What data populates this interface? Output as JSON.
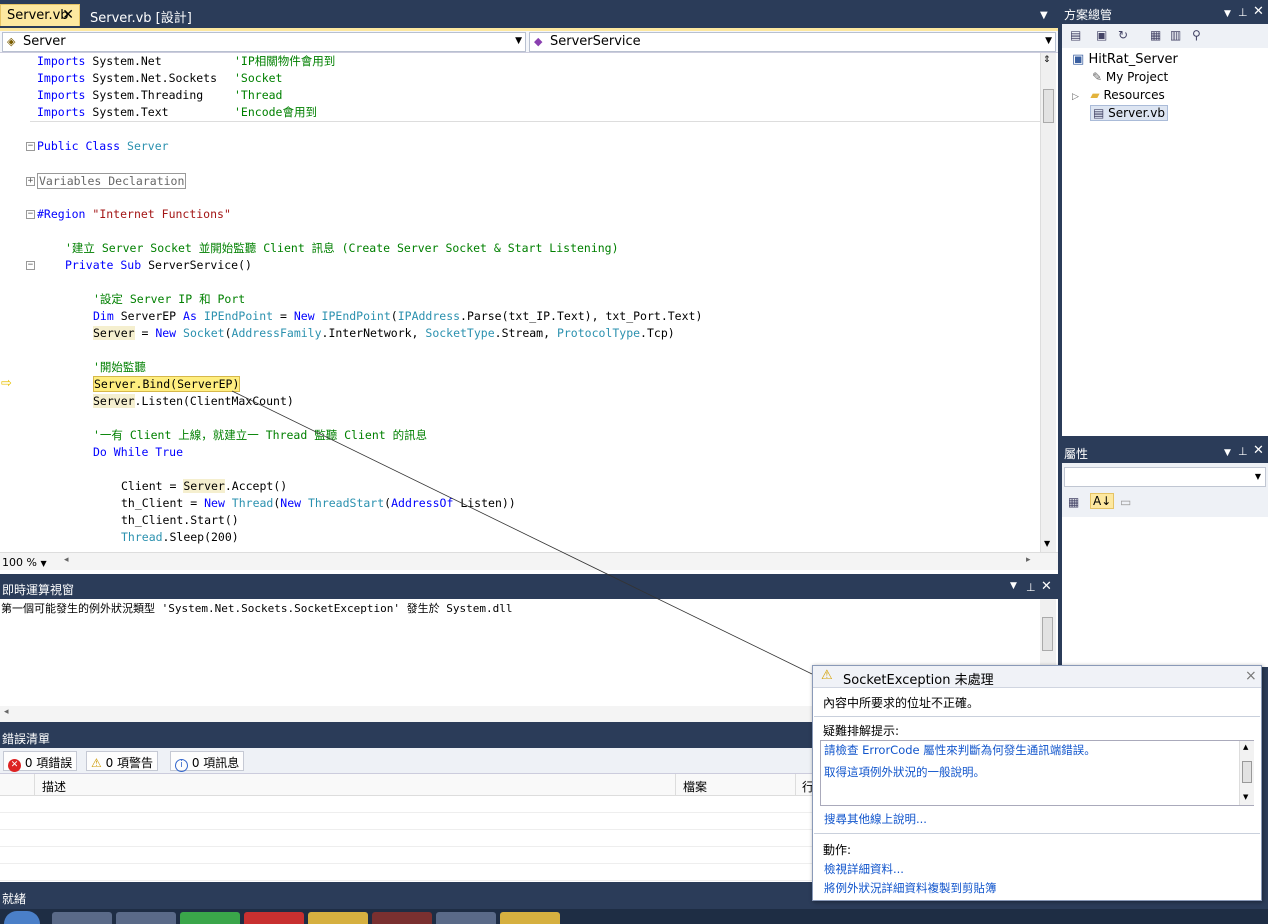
{
  "tabs": [
    {
      "label": "Server.vb",
      "close": "✕"
    },
    {
      "label": "Server.vb [設計]"
    }
  ],
  "nav": {
    "left": "Server",
    "right": "ServerService"
  },
  "code": {
    "imports": [
      {
        "ns": "System.Net",
        "comment": "'IP相關物件會用到"
      },
      {
        "ns": "System.Net.Sockets",
        "comment": "'Socket"
      },
      {
        "ns": "System.Threading",
        "comment": "'Thread"
      },
      {
        "ns": "System.Text",
        "comment": "'Encode會用到"
      }
    ],
    "kw_imports": "Imports",
    "class_kw": "Public Class",
    "class_name": "Server",
    "region_collapsed": "Variables Declaration",
    "region_kw": "#Region",
    "region_name": "\"Internet Functions\"",
    "comment1": "'建立 Server Socket 並開始監聽 Client 訊息 (Create Server Socket & Start Listening)",
    "sub_kw": "Private Sub",
    "sub_name": " ServerService()",
    "comment2": "'設定 Server IP 和 Port",
    "l_dim_a": "Dim",
    "l_dim_b": " ServerEP ",
    "l_dim_c": "As",
    "l_dim_d": " IPEndPoint",
    "l_dim_e": " = ",
    "l_dim_f": "New",
    "l_dim_g": " IPEndPoint",
    "l_dim_h": "(",
    "l_dim_i": "IPAddress",
    "l_dim_j": ".Parse(txt_IP.Text), txt_Port.Text)",
    "l_sock_a": "Server",
    "l_sock_b": " = ",
    "l_sock_c": "New",
    "l_sock_d": " Socket",
    "l_sock_e": "(",
    "l_sock_f": "AddressFamily",
    "l_sock_g": ".InterNetwork, ",
    "l_sock_h": "SocketType",
    "l_sock_i": ".Stream, ",
    "l_sock_j": "ProtocolType",
    "l_sock_k": ".Tcp)",
    "comment3": "'開始監聽",
    "l_bind": "Server.Bind(ServerEP)",
    "l_listen_a": "Server",
    "l_listen_b": ".Listen(ClientMaxCount)",
    "comment4": "'一有 Client 上線，就建立一 Thread 監聽 Client 的訊息",
    "l_do": "Do While True",
    "l_acc_a": "Client = ",
    "l_acc_b": "Server",
    "l_acc_c": ".Accept()",
    "l_th_a": "th_Client = ",
    "l_th_b": "New",
    "l_th_c": " Thread",
    "l_th_d": "(",
    "l_th_e": "New",
    "l_th_f": " ThreadStart",
    "l_th_g": "(",
    "l_th_h": "AddressOf",
    "l_th_i": " Listen))",
    "l_start": "th_Client.Start()",
    "l_sleep_a": "Thread",
    "l_sleep_b": ".Sleep(200)"
  },
  "zoom": "100 %",
  "immediate": {
    "title": "即時運算視窗",
    "output": "第一個可能發生的例外狀況類型 'System.Net.Sockets.SocketException' 發生於 System.dll"
  },
  "errors": {
    "title": "錯誤清單",
    "btn_errors": "0 項錯誤",
    "btn_warnings": "0 項警告",
    "btn_messages": "0 項訊息",
    "col_desc": "描述",
    "col_file": "檔案",
    "col_line": "行"
  },
  "status": {
    "text": "就緒"
  },
  "solution": {
    "title": "方案總管",
    "project": "HitRat_Server",
    "items": [
      "My Project",
      "Resources",
      "Server.vb"
    ]
  },
  "properties": {
    "title": "屬性"
  },
  "popup": {
    "title": "SocketException 未處理",
    "message": "內容中所要求的位址不正確。",
    "tips_head": "疑難排解提示:",
    "tips": [
      "請檢查 ErrorCode 屬性來判斷為何發生通訊端錯誤。",
      "取得這項例外狀況的一般說明。"
    ],
    "search": "搜尋其他線上說明...",
    "actions_head": "動作:",
    "actions": [
      "檢視詳細資料...",
      "將例外狀況詳細資料複製到剪貼簿"
    ],
    "close": "×"
  },
  "colors": {
    "ide_bg": "#2b3c59",
    "active_tab": "#fde8a0",
    "keyword": "#0000ff",
    "type": "#2b91af",
    "comment": "#008000",
    "string": "#a31515"
  }
}
